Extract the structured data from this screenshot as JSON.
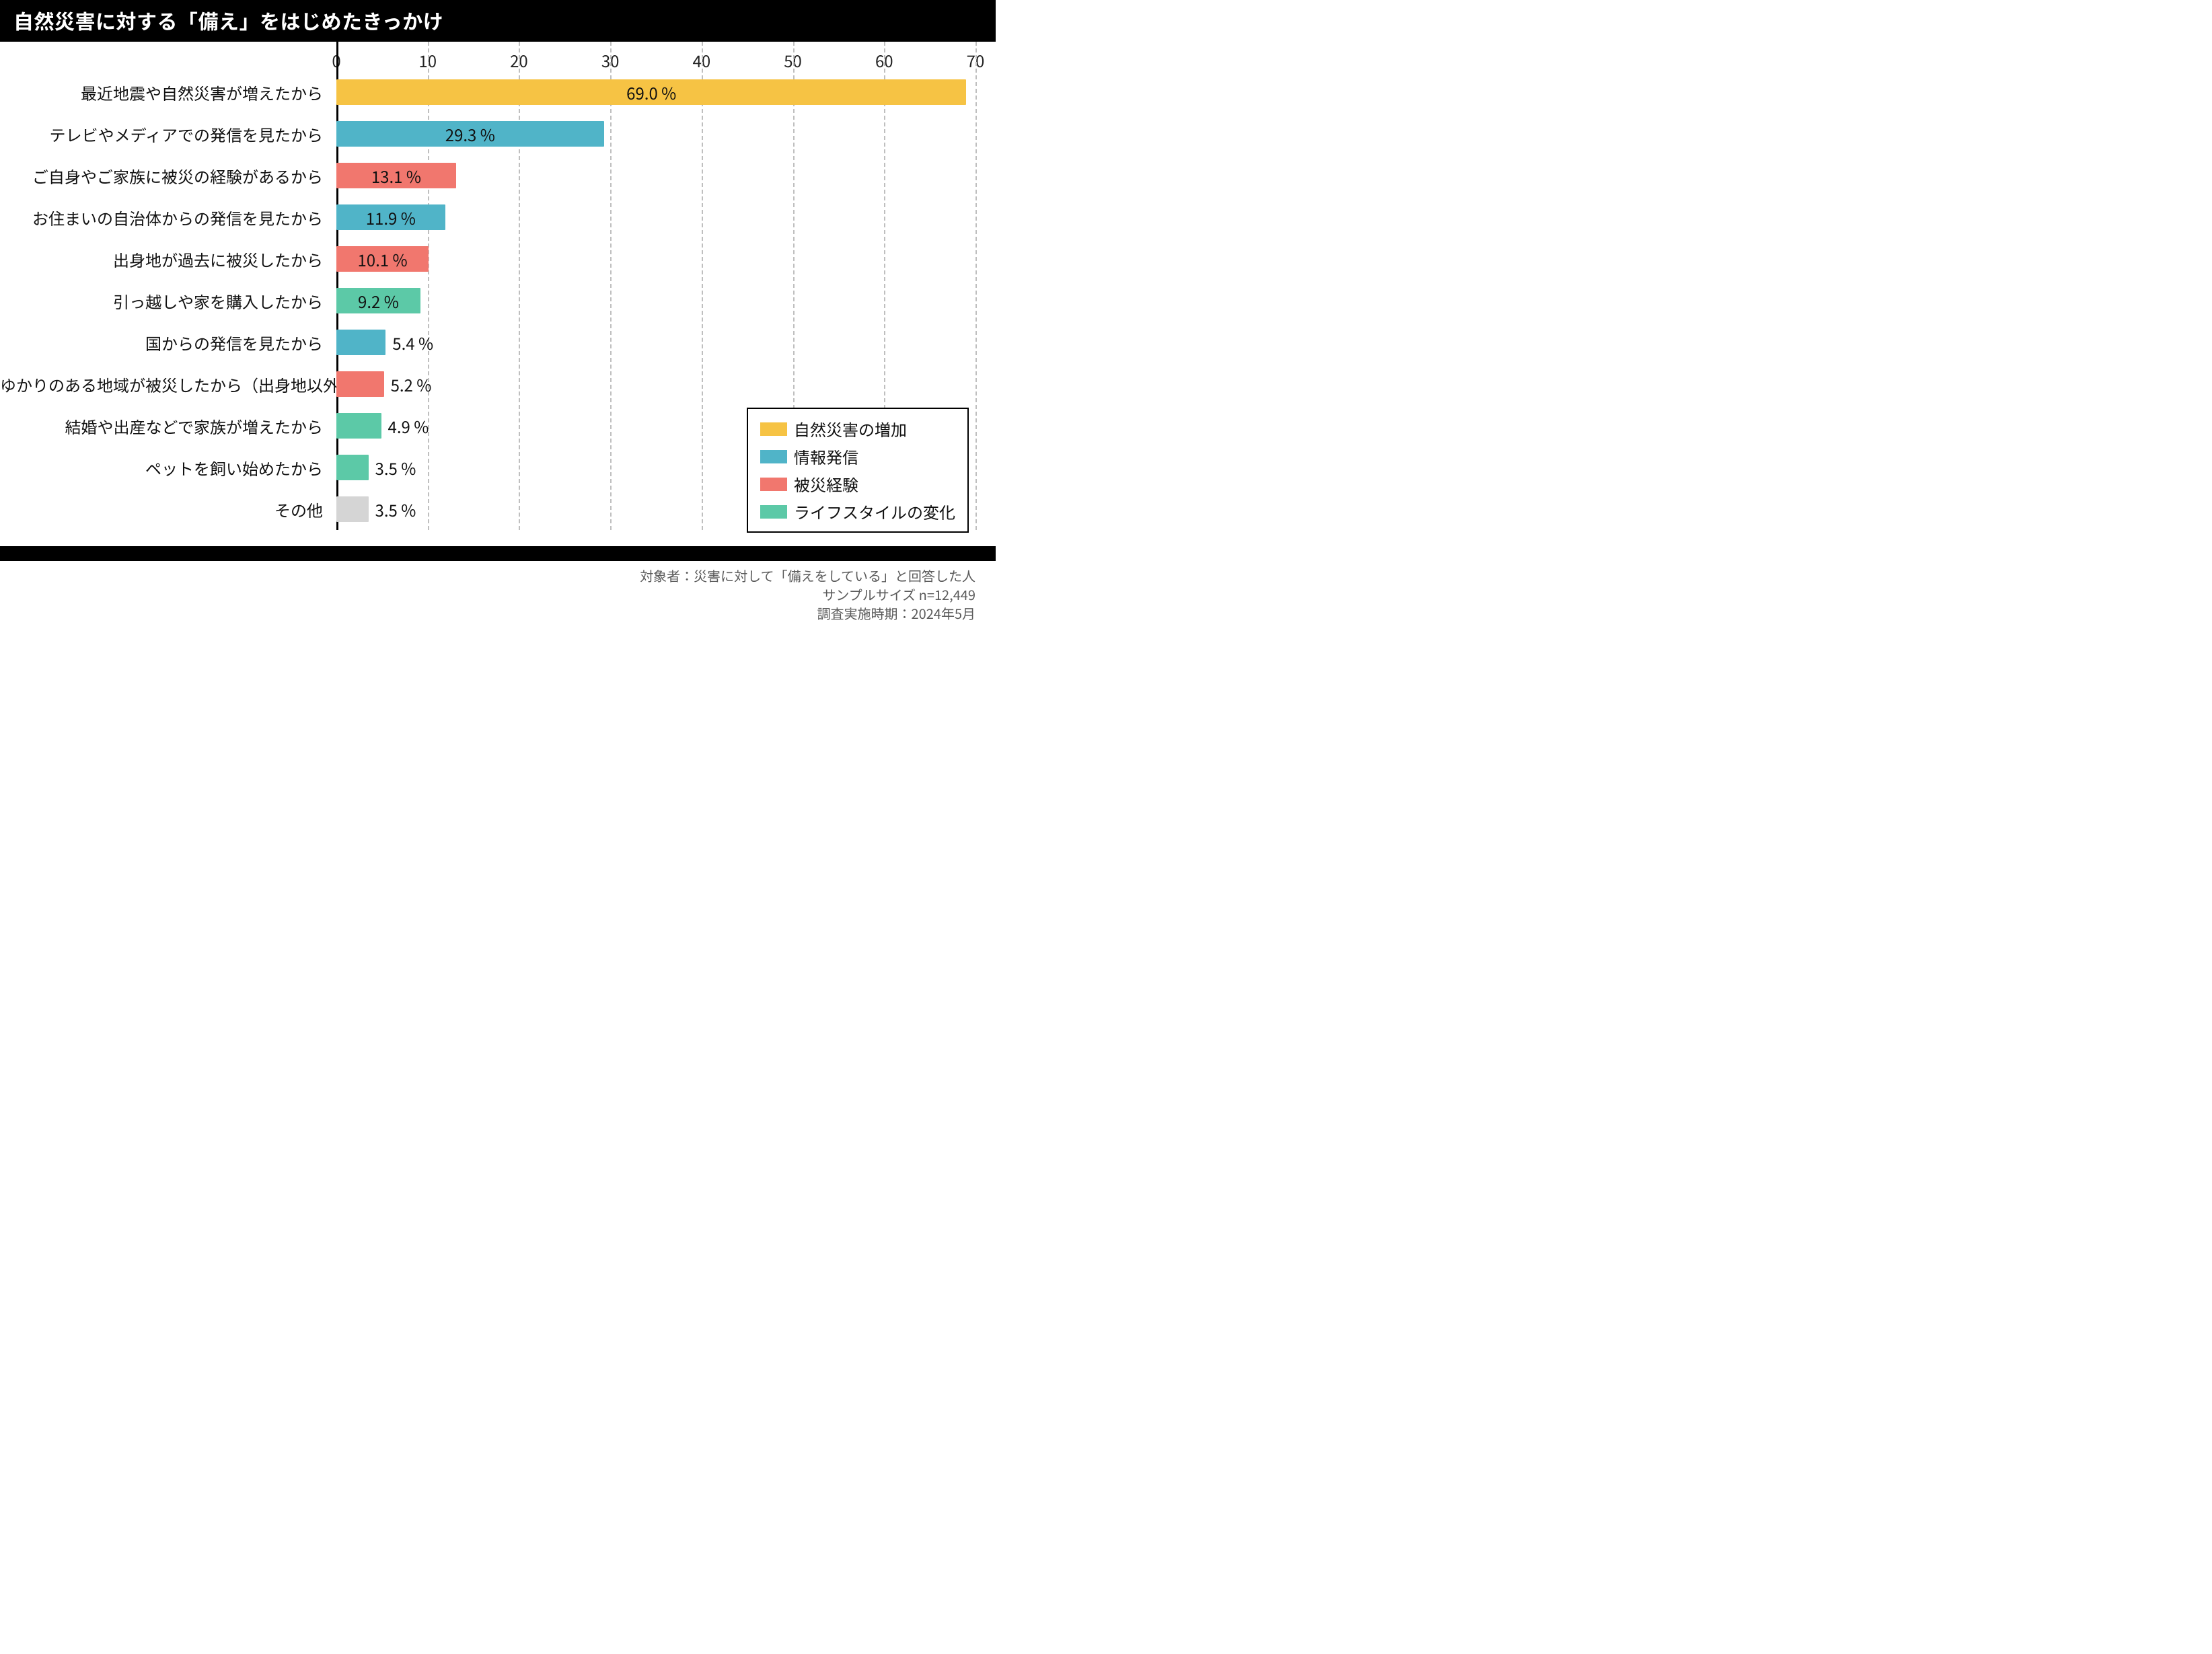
{
  "title": "自然災害に対する「備え」をはじめたきっかけ",
  "xmax": 70,
  "ticks": [
    0,
    10,
    20,
    30,
    40,
    50,
    60,
    70
  ],
  "colors": {
    "increase": "#F6C344",
    "info": "#50B4C8",
    "experience": "#F1776E",
    "lifestyle": "#5CC9A7",
    "other": "#D5D5D5"
  },
  "legend": [
    {
      "colorKey": "increase",
      "label": "自然災害の増加"
    },
    {
      "colorKey": "info",
      "label": "情報発信"
    },
    {
      "colorKey": "experience",
      "label": "被災経験"
    },
    {
      "colorKey": "lifestyle",
      "label": "ライフスタイルの変化"
    }
  ],
  "rows": [
    {
      "label": "最近地震や自然災害が増えたから",
      "value": 69.0,
      "display": "69.0 %",
      "colorKey": "increase",
      "labelInside": true
    },
    {
      "label": "テレビやメディアでの発信を見たから",
      "value": 29.3,
      "display": "29.3 %",
      "colorKey": "info",
      "labelInside": true
    },
    {
      "label": "ご自身やご家族に被災の経験があるから",
      "value": 13.1,
      "display": "13.1 %",
      "colorKey": "experience",
      "labelInside": true
    },
    {
      "label": "お住まいの自治体からの発信を見たから",
      "value": 11.9,
      "display": "11.9 %",
      "colorKey": "info",
      "labelInside": true
    },
    {
      "label": "出身地が過去に被災したから",
      "value": 10.1,
      "display": "10.1 %",
      "colorKey": "experience",
      "labelInside": true
    },
    {
      "label": "引っ越しや家を購入したから",
      "value": 9.2,
      "display": "9.2 %",
      "colorKey": "lifestyle",
      "labelInside": true
    },
    {
      "label": "国からの発信を見たから",
      "value": 5.4,
      "display": "5.4 %",
      "colorKey": "info",
      "labelInside": false
    },
    {
      "label": "ゆかりのある地域が被災したから（出身地以外）",
      "value": 5.2,
      "display": "5.2 %",
      "colorKey": "experience",
      "labelInside": false
    },
    {
      "label": "結婚や出産などで家族が増えたから",
      "value": 4.9,
      "display": "4.9 %",
      "colorKey": "lifestyle",
      "labelInside": false
    },
    {
      "label": "ペットを飼い始めたから",
      "value": 3.5,
      "display": "3.5 %",
      "colorKey": "lifestyle",
      "labelInside": false
    },
    {
      "label": "その他",
      "value": 3.5,
      "display": "3.5 %",
      "colorKey": "other",
      "labelInside": false
    }
  ],
  "footnotes": [
    "対象者：災害に対して「備えをしている」と回答した人",
    "サンプルサイズ n=12,449",
    "調査実施時期：2024年5月"
  ],
  "chart_data": {
    "type": "bar",
    "orientation": "horizontal",
    "title": "自然災害に対する「備え」をはじめたきっかけ",
    "xlabel": "",
    "ylabel": "",
    "xlim": [
      0,
      70
    ],
    "unit": "%",
    "categories": [
      "最近地震や自然災害が増えたから",
      "テレビやメディアでの発信を見たから",
      "ご自身やご家族に被災の経験があるから",
      "お住まいの自治体からの発信を見たから",
      "出身地が過去に被災したから",
      "引っ越しや家を購入したから",
      "国からの発信を見たから",
      "ゆかりのある地域が被災したから（出身地以外）",
      "結婚や出産などで家族が増えたから",
      "ペットを飼い始めたから",
      "その他"
    ],
    "values": [
      69.0,
      29.3,
      13.1,
      11.9,
      10.1,
      9.2,
      5.4,
      5.2,
      4.9,
      3.5,
      3.5
    ],
    "group": [
      "自然災害の増加",
      "情報発信",
      "被災経験",
      "情報発信",
      "被災経験",
      "ライフスタイルの変化",
      "情報発信",
      "被災経験",
      "ライフスタイルの変化",
      "ライフスタイルの変化",
      "その他"
    ],
    "legend": [
      "自然災害の増加",
      "情報発信",
      "被災経験",
      "ライフスタイルの変化"
    ],
    "legend_position": "bottom-right",
    "grid": "x-dashed"
  }
}
